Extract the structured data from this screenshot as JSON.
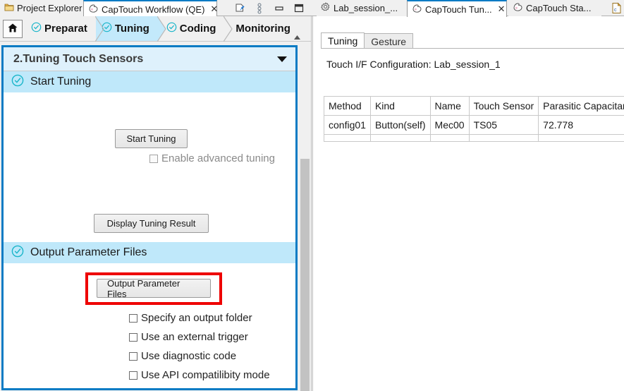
{
  "left_window": {
    "tabs": [
      {
        "label": "Project Explorer",
        "icon": "project-explorer-icon",
        "active": false,
        "closable": false
      },
      {
        "label": "CapTouch Workflow (QE)",
        "icon": "captouch-workflow-icon",
        "active": true,
        "closable": true
      }
    ],
    "window_controls": [
      {
        "name": "pin-editor-icon",
        "glyph": "pin"
      },
      {
        "name": "view-menu-icon",
        "glyph": "dots"
      },
      {
        "name": "minimize-icon",
        "glyph": "minimize"
      },
      {
        "name": "maximize-icon",
        "glyph": "maximize"
      }
    ],
    "stepbar": {
      "home_icon": "home-icon",
      "scroll_up_icon": "scroll-up-arrow-icon",
      "steps": [
        {
          "label": "Preparat",
          "checked": true,
          "selected": false
        },
        {
          "label": "Tuning",
          "checked": true,
          "selected": true
        },
        {
          "label": "Coding",
          "checked": true,
          "selected": false
        },
        {
          "label": "Monitoring",
          "checked": false,
          "selected": false
        }
      ]
    },
    "wizard": {
      "section_title": "2.Tuning Touch Sensors",
      "collapse_icon": "chevron-down-icon",
      "groups": [
        {
          "title": "Start Tuning",
          "status_icon": "check-circle-icon",
          "buttons": [
            {
              "label": "Start Tuning",
              "name": "start-tuning-button"
            },
            {
              "label": "Display Tuning Result",
              "name": "display-tuning-result-button"
            }
          ],
          "checkboxes": [
            {
              "label": "Enable advanced tuning",
              "checked": false,
              "disabled": true
            }
          ]
        },
        {
          "title": "Output Parameter Files",
          "status_icon": "check-circle-icon",
          "buttons": [
            {
              "label": "Output Parameter Files",
              "name": "output-parameter-files-button",
              "highlighted": true
            }
          ],
          "checkboxes": [
            {
              "label": "Specify an output folder",
              "checked": false,
              "disabled": false
            },
            {
              "label": "Use an external trigger",
              "checked": false,
              "disabled": false
            },
            {
              "label": "Use diagnostic code",
              "checked": false,
              "disabled": false
            },
            {
              "label": "Use API compatilibity mode",
              "checked": false,
              "disabled": false
            }
          ]
        }
      ]
    },
    "scrollbar": {
      "name": "left-pane-vertical-scrollbar"
    }
  },
  "right_window": {
    "tabs": [
      {
        "label": "Lab_session_...",
        "icon": "gear-icon",
        "active": false,
        "closable": false
      },
      {
        "label": "CapTouch Tun...",
        "icon": "captouch-tuning-icon",
        "active": true,
        "closable": true
      },
      {
        "label": "CapTouch Sta...",
        "icon": "captouch-status-icon",
        "active": false,
        "closable": false
      }
    ],
    "overflow_tab_icon": "c-source-file-icon",
    "inner_tabs": [
      {
        "label": "Tuning",
        "selected": true
      },
      {
        "label": "Gesture",
        "selected": false
      }
    ],
    "config_label": "Touch I/F Configuration: Lab_session_1",
    "table": {
      "headers": [
        "Method",
        "Kind",
        "Name",
        "Touch Sensor",
        "Parasitic Capacitance[p"
      ],
      "rows": [
        [
          "config01",
          "Button(self)",
          "Mec00",
          "TS05",
          "72.778"
        ]
      ]
    }
  },
  "colors": {
    "accent_blue": "#0a7bc4",
    "section_header_bg": "#def1fc",
    "group_header_bg": "#bfe8fa",
    "check_teal": "#19b5c9",
    "highlight_red": "#ee0000",
    "chrome_gray": "#f0f0f0"
  }
}
